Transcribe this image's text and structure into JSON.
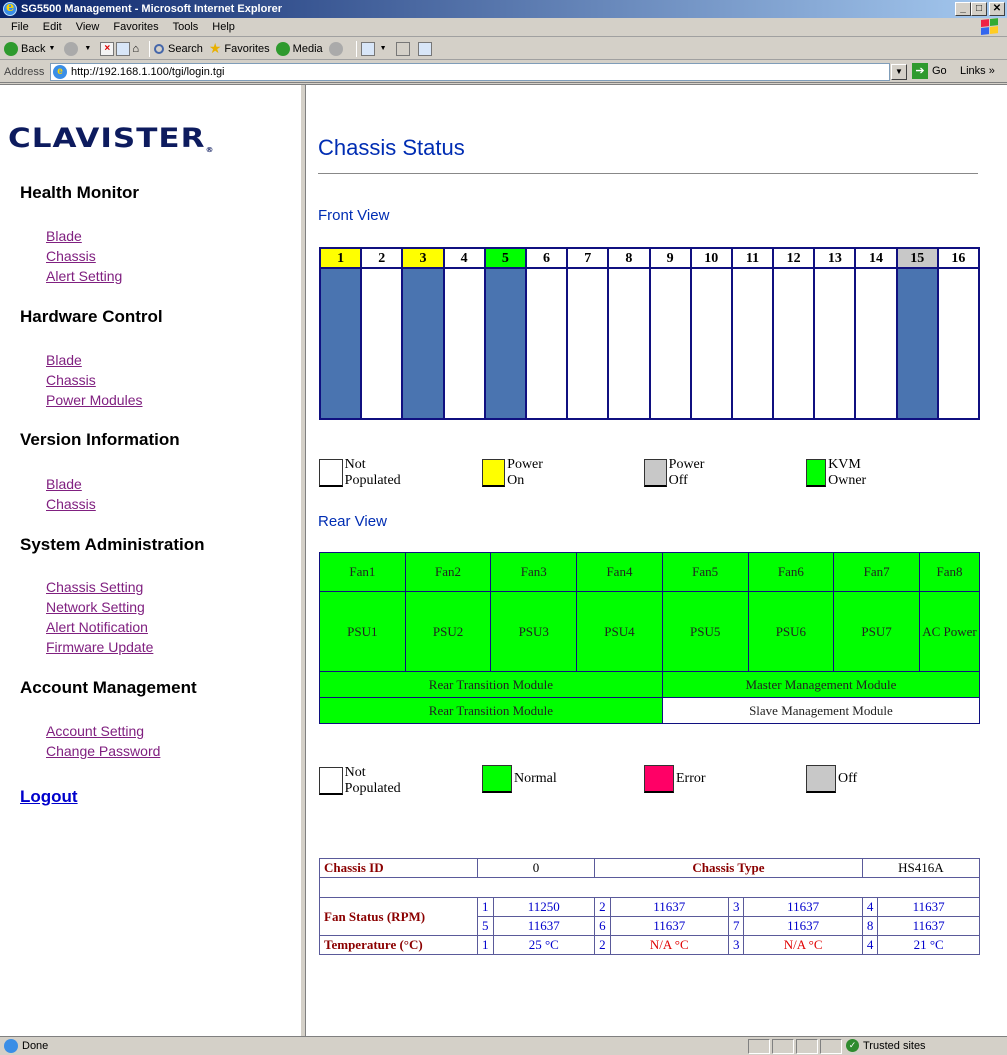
{
  "window": {
    "title": "SG5500 Management - Microsoft Internet Explorer"
  },
  "menu": [
    "File",
    "Edit",
    "View",
    "Favorites",
    "Tools",
    "Help"
  ],
  "toolbar": {
    "back": "Back",
    "search": "Search",
    "favorites": "Favorites",
    "media": "Media"
  },
  "address": {
    "label": "Address",
    "url": "http://192.168.1.100/tgi/login.tgi",
    "go": "Go",
    "links": "Links »"
  },
  "sidebar": {
    "logo": "CLAVISTER",
    "sections": [
      {
        "title": "Health Monitor",
        "links": [
          "Blade",
          "Chassis",
          "Alert Setting"
        ]
      },
      {
        "title": "Hardware Control",
        "links": [
          "Blade",
          "Chassis",
          "Power Modules"
        ]
      },
      {
        "title": "Version Information",
        "links": [
          "Blade",
          "Chassis"
        ]
      },
      {
        "title": "System Administration",
        "links": [
          "Chassis Setting",
          "Network Setting",
          "Alert Notification",
          "Firmware Update"
        ]
      },
      {
        "title": "Account Management",
        "links": [
          "Account Setting",
          "Change Password"
        ]
      }
    ],
    "logout": "Logout"
  },
  "main": {
    "title": "Chassis Status",
    "front_view": {
      "title": "Front View",
      "slots": [
        {
          "num": "1",
          "header": "yellow",
          "populated": true
        },
        {
          "num": "2",
          "header": "white",
          "populated": false
        },
        {
          "num": "3",
          "header": "yellow",
          "populated": true
        },
        {
          "num": "4",
          "header": "white",
          "populated": false
        },
        {
          "num": "5",
          "header": "green",
          "populated": true
        },
        {
          "num": "6",
          "header": "white",
          "populated": false
        },
        {
          "num": "7",
          "header": "white",
          "populated": false
        },
        {
          "num": "8",
          "header": "white",
          "populated": false
        },
        {
          "num": "9",
          "header": "white",
          "populated": false
        },
        {
          "num": "10",
          "header": "white",
          "populated": false
        },
        {
          "num": "11",
          "header": "white",
          "populated": false
        },
        {
          "num": "12",
          "header": "white",
          "populated": false
        },
        {
          "num": "13",
          "header": "white",
          "populated": false
        },
        {
          "num": "14",
          "header": "white",
          "populated": false
        },
        {
          "num": "15",
          "header": "grey",
          "populated": true
        },
        {
          "num": "16",
          "header": "white",
          "populated": false
        }
      ],
      "legend": [
        {
          "label": "Not Populated",
          "color": "#ffffff"
        },
        {
          "label": "Power On",
          "color": "#ffff00"
        },
        {
          "label": "Power Off",
          "color": "#c8c8c8"
        },
        {
          "label": "KVM Owner",
          "color": "#00ff00"
        }
      ]
    },
    "rear_view": {
      "title": "Rear View",
      "fans": [
        "Fan1",
        "Fan2",
        "Fan3",
        "Fan4",
        "Fan5",
        "Fan6",
        "Fan7",
        "Fan8"
      ],
      "psus": [
        "PSU1",
        "PSU2",
        "PSU3",
        "PSU4",
        "PSU5",
        "PSU6",
        "PSU7"
      ],
      "ac_power": "AC Power",
      "modules": [
        [
          "Rear Transition Module",
          "Master Management Module"
        ],
        [
          "Rear Transition Module",
          "Slave Management Module"
        ]
      ],
      "legend": [
        {
          "label": "Not Populated",
          "color": "#ffffff"
        },
        {
          "label": "Normal",
          "color": "#00ff00"
        },
        {
          "label": "Error",
          "color": "#ff0066"
        },
        {
          "label": "Off",
          "color": "#c8c8c8"
        }
      ]
    },
    "status": {
      "chassis_id_label": "Chassis ID",
      "chassis_id": "0",
      "chassis_type_label": "Chassis Type",
      "chassis_type": "HS416A",
      "fan_label": "Fan Status (RPM)",
      "fans": [
        {
          "idx": "1",
          "rpm": "11250"
        },
        {
          "idx": "2",
          "rpm": "11637"
        },
        {
          "idx": "3",
          "rpm": "11637"
        },
        {
          "idx": "4",
          "rpm": "11637"
        },
        {
          "idx": "5",
          "rpm": "11637"
        },
        {
          "idx": "6",
          "rpm": "11637"
        },
        {
          "idx": "7",
          "rpm": "11637"
        },
        {
          "idx": "8",
          "rpm": "11637"
        }
      ],
      "temp_label": "Temperature (°C)",
      "temps": [
        {
          "idx": "1",
          "value": "25 °C",
          "na": false
        },
        {
          "idx": "2",
          "value": "N/A °C",
          "na": true
        },
        {
          "idx": "3",
          "value": "N/A °C",
          "na": true
        },
        {
          "idx": "4",
          "value": "21 °C",
          "na": false
        }
      ]
    }
  },
  "statusbar": {
    "text": "Done",
    "zone": "Trusted sites"
  },
  "colors": {
    "slot_fill": "#4a74b0",
    "green": "#00ff00",
    "yellow": "#ffff00",
    "grey": "#c8c8c8",
    "link": "#802080",
    "heading": "#002db3"
  }
}
